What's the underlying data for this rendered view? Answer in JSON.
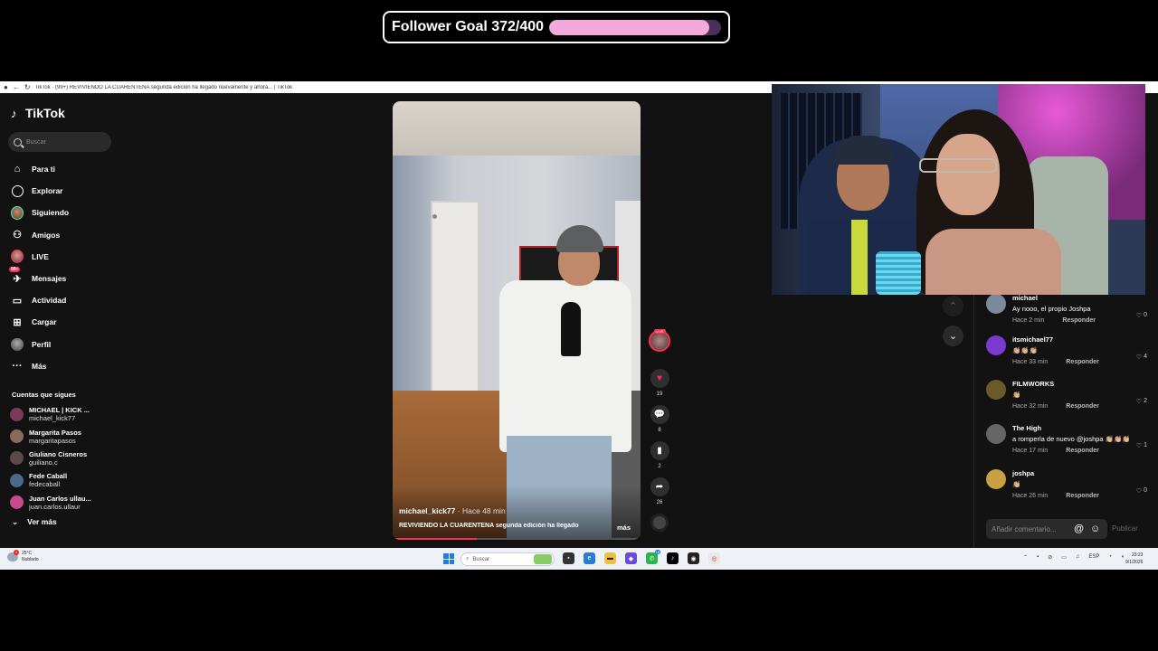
{
  "overlay": {
    "goal_text": "Follower Goal 372/400",
    "goal_current": 372,
    "goal_target": 400
  },
  "browser": {
    "title": "TikTok · (99+) REVIVIENDO LA CUARENTENA segunda edición ha llegado nuevamente y ahora... | TikTok"
  },
  "sidebar": {
    "logo": "TikTok",
    "search_placeholder": "Buscar",
    "nav": [
      {
        "label": "Para ti",
        "icon": "home-icon"
      },
      {
        "label": "Explorar",
        "icon": "compass-icon"
      },
      {
        "label": "Siguiendo",
        "icon": "following-avatar-icon"
      },
      {
        "label": "Amigos",
        "icon": "friends-icon"
      },
      {
        "label": "LIVE",
        "icon": "live-avatar-icon"
      },
      {
        "label": "Mensajes",
        "icon": "messages-icon",
        "badge": "99+"
      },
      {
        "label": "Actividad",
        "icon": "activity-icon"
      },
      {
        "label": "Cargar",
        "icon": "upload-icon"
      },
      {
        "label": "Perfil",
        "icon": "profile-avatar-icon"
      },
      {
        "label": "Más",
        "icon": "more-icon"
      }
    ],
    "following_header": "Cuentas que sigues",
    "following": [
      {
        "name": "MICHAEL | KICK ...",
        "user": "michael_kick77",
        "color": "#7a3a5a"
      },
      {
        "name": "Margarita Pasos",
        "user": "margaritapasos",
        "color": "#8a6a5a"
      },
      {
        "name": "Giuliano Cisneros",
        "user": "guiliano.c",
        "color": "#5a4a4a"
      },
      {
        "name": "Fede Caball",
        "user": "fedecaball",
        "color": "#4a6a8a"
      },
      {
        "name": "Juan Carlos ullau...",
        "user": "juan.carlos.ullaur",
        "color": "#c84a8a"
      }
    ],
    "see_more": "Ver más"
  },
  "video": {
    "author": "michael_kick77",
    "time": "· Hace 48 min",
    "description": "REVIVIENDO LA CUARENTENA segunda edición ha llegado",
    "more": "más",
    "progress": 0.34
  },
  "actions": {
    "live_tag": "LIVE",
    "likes": "19",
    "comments": "8",
    "saves": "2",
    "shares": "26"
  },
  "comments": {
    "list": [
      {
        "name": "michael",
        "text": "Ay nooo, el propio Joshpa",
        "time": "Hace 2 min",
        "likes": "0",
        "color": "#7a8a9a"
      },
      {
        "name": "itsmichael77",
        "text": "👏🏼👏🏼👏🏼",
        "time": "Hace 33 min",
        "likes": "4",
        "color": "#7a3ad0"
      },
      {
        "name": "FILMWORKS",
        "text": "👏🏼",
        "time": "Hace 32 min",
        "likes": "2",
        "color": "#6a5a2a"
      },
      {
        "name": "The High",
        "text": "a romperla de nuevo @joshpa 👏🏼👏🏼👏🏼",
        "time": "Hace 17 min",
        "likes": "1",
        "color": "#666666"
      },
      {
        "name": "joshpa",
        "text": "👏🏼",
        "time": "Hace 26 min",
        "likes": "0",
        "color": "#c8a040"
      }
    ],
    "reply_label": "Responder",
    "input_placeholder": "Añadir comentario...",
    "publish": "Publicar"
  },
  "taskbar": {
    "weather_temp": "25°C",
    "weather_desc": "Nublado",
    "weather_badge": "4",
    "search_placeholder": "Buscar",
    "whatsapp_badge": "18",
    "lang": "ESP",
    "time": "23:23",
    "date": "9/1/2026"
  },
  "colors": {
    "accent": "#fe2c55",
    "goal_fill": "#f3a9dc",
    "goal_track": "#4a2f5a",
    "app_bg": "#121212"
  }
}
